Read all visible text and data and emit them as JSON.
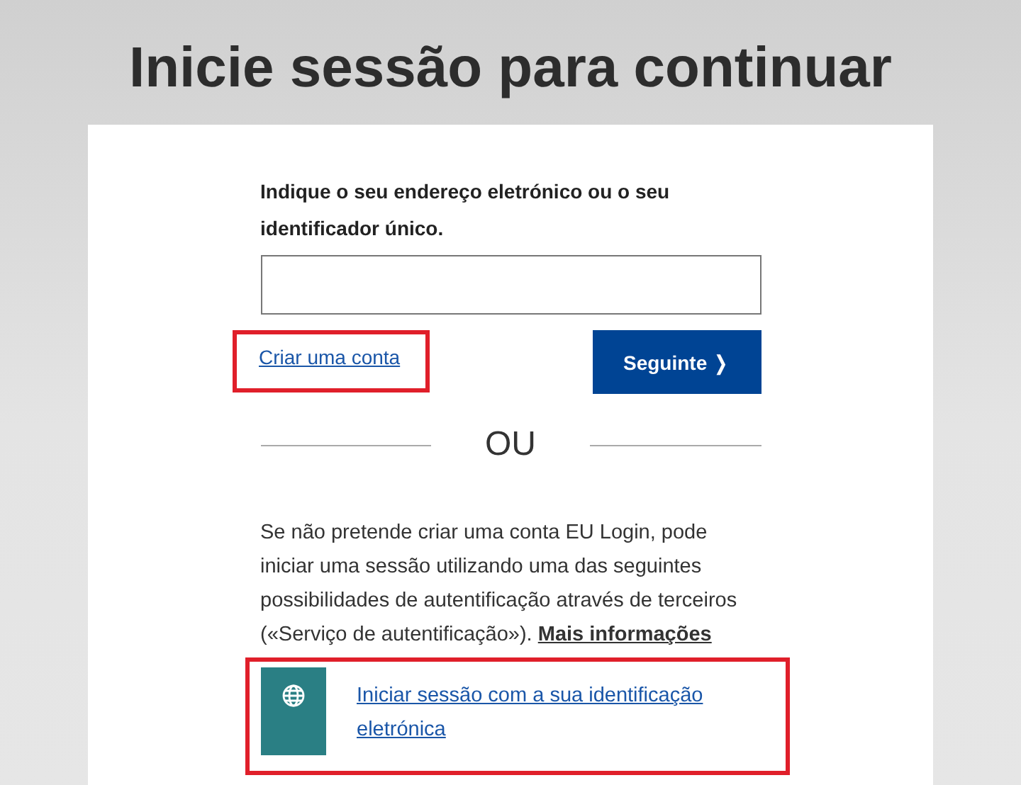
{
  "heading": "Inicie sessão para continuar",
  "form": {
    "label": "Indique o seu endereço eletrónico ou o seu identificador único.",
    "create_account": {
      "label": "Criar uma conta",
      "highlighted": true
    },
    "next_button": "Seguinte ❭"
  },
  "separator": "OU",
  "info": {
    "text": "Se não pretende criar uma conta EU Login, pode iniciar uma sessão utilizando uma das seguintes possibilidades de autentificação através de terceiros («Serviço de autentificação»).",
    "link": "Mais informações"
  },
  "providers": [
    {
      "label": "Iniciar sessão com a sua identificação eletrónica",
      "highlighted": true
    }
  ]
}
